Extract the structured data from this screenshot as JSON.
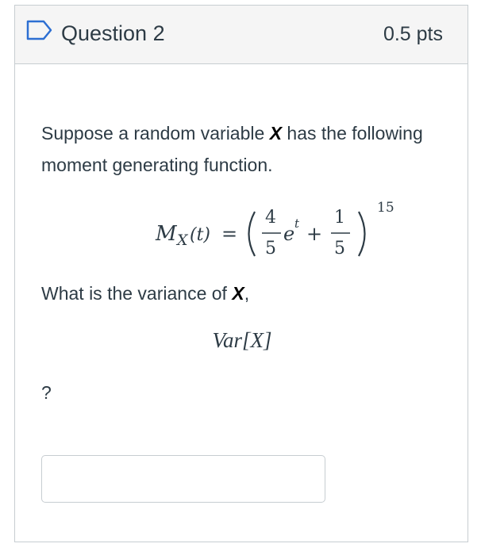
{
  "question": {
    "title": "Question 2",
    "points": "0.5 pts",
    "text_part1": "Suppose a random variable ",
    "text_var": "X",
    "text_part2": " has the following moment generating function.",
    "formula": {
      "lhs_M": "M",
      "lhs_sub": "X",
      "lhs_arg": "(t)",
      "equals": "=",
      "frac1_num": "4",
      "frac1_den": "5",
      "exp_base": "e",
      "exp_power": "t",
      "plus": "+",
      "frac2_num": "1",
      "frac2_den": "5",
      "outer_power": "15"
    },
    "prompt_part1": "What is the variance of ",
    "prompt_var": "X",
    "prompt_part2": ",",
    "var_expr": "Var[X]",
    "trailing": "?",
    "answer_value": "",
    "answer_placeholder": ""
  },
  "colors": {
    "flag_icon": "#2d6fd2",
    "border": "#c7cdd1",
    "header_bg": "#f5f5f5",
    "text": "#2d3b45"
  }
}
